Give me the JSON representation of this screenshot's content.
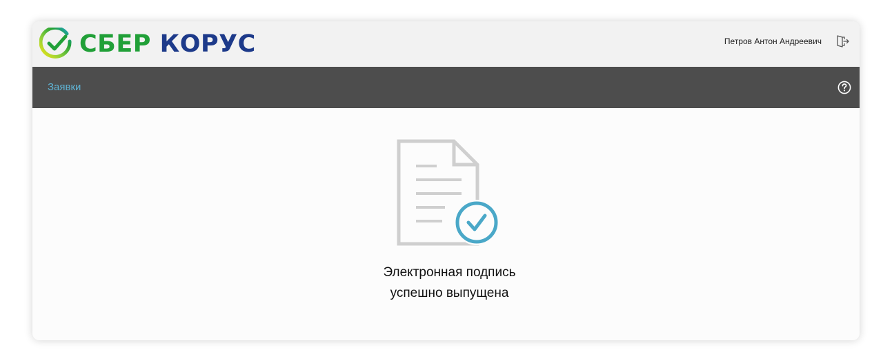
{
  "header": {
    "logo": {
      "brand": "СБЕР",
      "product": "КОРУС"
    },
    "user_name": "Петров Антон Андреевич",
    "logout_icon": "logout-icon"
  },
  "navbar": {
    "link_label": "Заявки",
    "help_icon": "help-icon"
  },
  "main": {
    "illustration_icon": "document-check-icon",
    "message_line1": "Электронная подпись",
    "message_line2": "успешно выпущена"
  },
  "colors": {
    "brand_green": "#21a038",
    "brand_blue": "#1d3a8a",
    "navbar_bg": "#4d4d4d",
    "link": "#5fb3d4",
    "check_accent": "#4aa8c8"
  }
}
